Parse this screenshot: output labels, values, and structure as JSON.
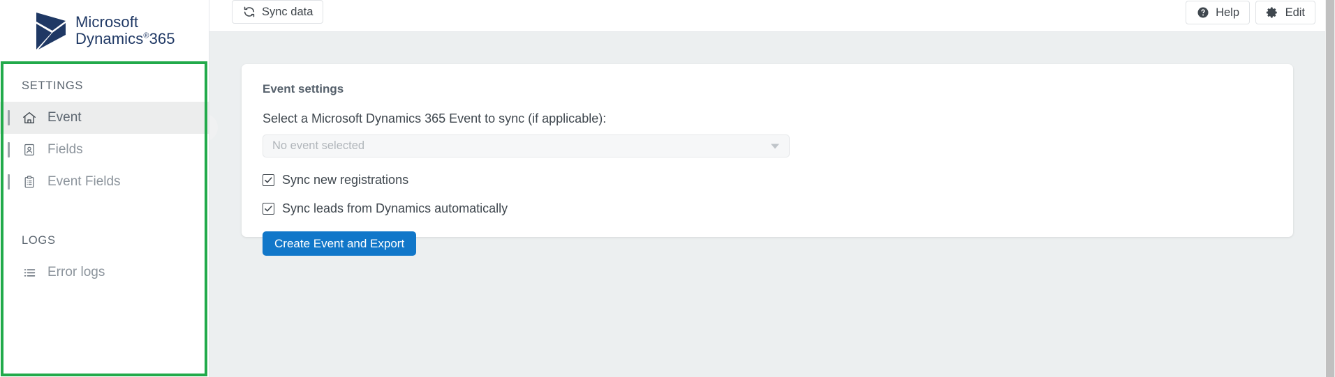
{
  "brand": {
    "logo_icon": "dynamics-365-logo",
    "line1": "Microsoft",
    "line2": "Dynamics",
    "registered": "®",
    "product_number": "365",
    "logo_color": "#1f3864"
  },
  "topbar": {
    "sync_label": "Sync data",
    "sync_icon": "sync-refresh-icon",
    "help_label": "Help",
    "help_icon": "question-circle-icon",
    "edit_label": "Edit",
    "edit_icon": "gear-icon"
  },
  "sidebar": {
    "highlight_color": "#22aa4b",
    "sections": [
      {
        "title": "SETTINGS",
        "items": [
          {
            "label": "Event",
            "icon": "home-icon",
            "active": true
          },
          {
            "label": "Fields",
            "icon": "id-badge-icon",
            "active": false
          },
          {
            "label": "Event Fields",
            "icon": "clipboard-list-icon",
            "active": false
          }
        ]
      },
      {
        "title": "LOGS",
        "items": [
          {
            "label": "Error logs",
            "icon": "list-icon",
            "active": false
          }
        ]
      }
    ]
  },
  "panel": {
    "title": "Event settings",
    "select_label": "Select a Microsoft Dynamics 365 Event to sync (if applicable):",
    "select_placeholder": "No event selected",
    "select_value": "",
    "caret_icon": "chevron-down-icon",
    "checkboxes": [
      {
        "label": "Sync new registrations",
        "checked": true
      },
      {
        "label": "Sync leads from Dynamics automatically",
        "checked": true
      }
    ],
    "primary_button_label": "Create Event and Export",
    "primary_button_color": "#1177c9"
  }
}
